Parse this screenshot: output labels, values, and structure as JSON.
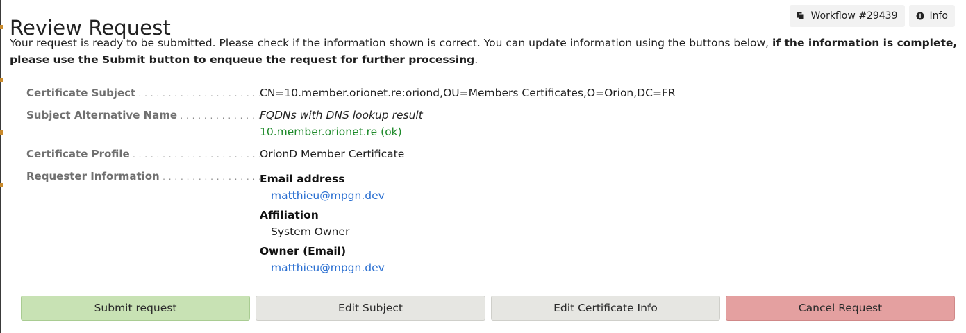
{
  "page": {
    "title": "Review Request",
    "workflow_label": "Workflow #29439",
    "info_label": "Info"
  },
  "intro": {
    "text_plain": "Your request is ready to be submitted. Please check if the information shown is correct. You can update information using the buttons below, ",
    "text_bold": "if the information is complete, please use the Submit button to enqueue the request for further processing",
    "text_end": "."
  },
  "fields": {
    "subject_label": "Certificate Subject",
    "subject_value": "CN=10.member.orionet.re:oriond,OU=Members Certificates,O=Orion,DC=FR",
    "san_label": "Subject Alternative Name",
    "san_caption": "FQDNs with DNS lookup result",
    "san_value": "10.member.orionet.re (ok)",
    "profile_label": "Certificate Profile",
    "profile_value": "OrionD Member Certificate",
    "requester_label": "Requester Information",
    "requester": {
      "email_title": "Email address",
      "email_value": "matthieu@mpgn.dev",
      "affiliation_title": "Affiliation",
      "affiliation_value": "System Owner",
      "owner_title": "Owner (Email)",
      "owner_value": "matthieu@mpgn.dev"
    }
  },
  "actions": {
    "submit": "Submit request",
    "edit_subject": "Edit Subject",
    "edit_cert_info": "Edit Certificate Info",
    "cancel": "Cancel Request"
  },
  "colors": {
    "submit_bg": "#c8e2b4",
    "edit_bg": "#e6e6e2",
    "cancel_bg": "#e4a0a0",
    "ok_text": "#1e8a2a",
    "link_text": "#2a6fd1"
  },
  "icons": {
    "workflow": "copy-icon",
    "info": "info-circle-icon"
  }
}
